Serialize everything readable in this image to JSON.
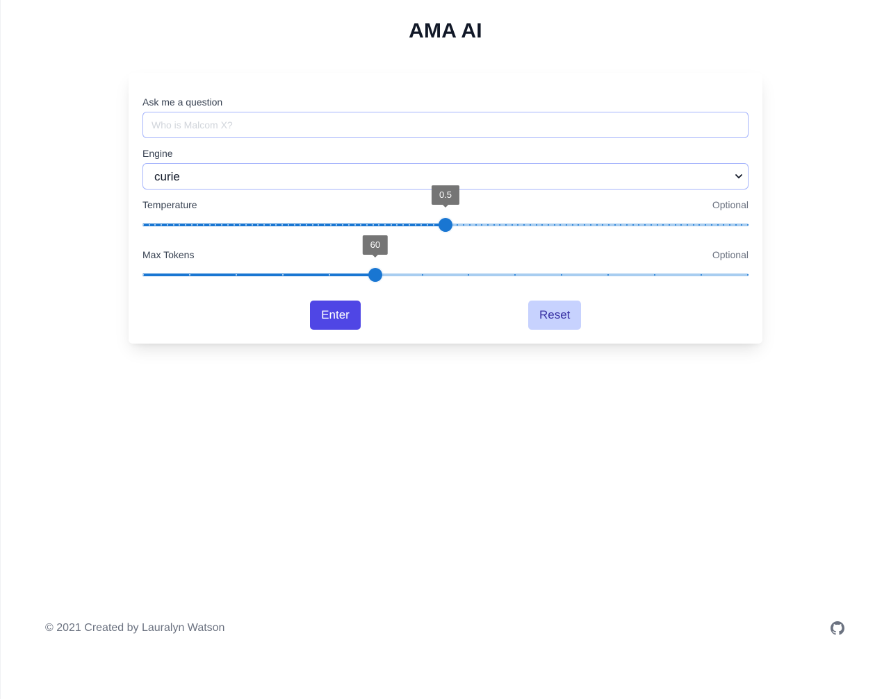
{
  "app": {
    "title": "AMA AI"
  },
  "form": {
    "question": {
      "label": "Ask me a question",
      "placeholder": "Who is Malcom X?",
      "value": ""
    },
    "engine": {
      "label": "Engine",
      "selected": "curie"
    },
    "temperature": {
      "label": "Temperature",
      "optional": "Optional",
      "value": "0.5",
      "fraction": 0.5,
      "tick_count": 101
    },
    "max_tokens": {
      "label": "Max Tokens",
      "optional": "Optional",
      "value": "60",
      "fraction": 0.384,
      "tick_count": 14
    },
    "enter_label": "Enter",
    "reset_label": "Reset"
  },
  "footer": {
    "copyright": "© 2021 Created by Lauralyn Watson",
    "github_icon": "github-icon"
  },
  "colors": {
    "accent": "#4f46e5",
    "accent_light": "#c7d2fe",
    "slider": "#1976d2",
    "slider_rail": "#a8cdf0",
    "tooltip": "#757575"
  }
}
